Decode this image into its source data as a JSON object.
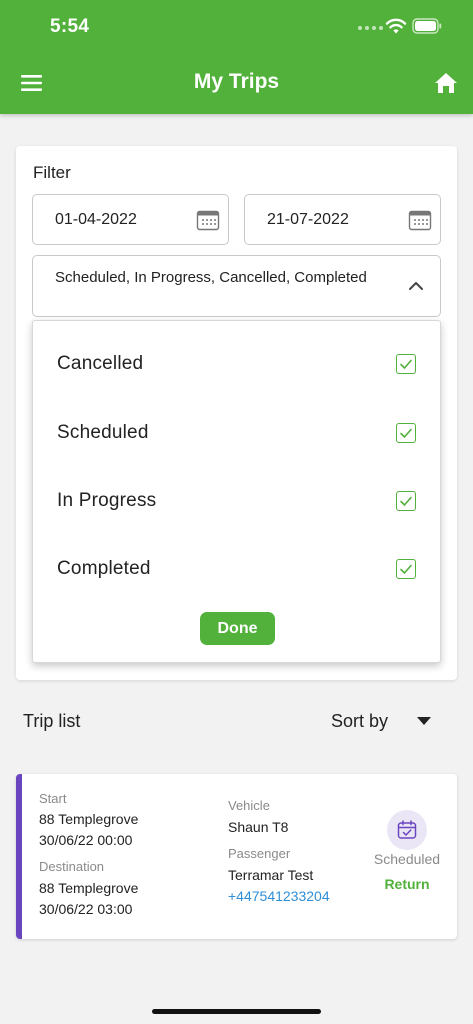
{
  "status_bar": {
    "time": "5:54"
  },
  "header": {
    "title": "My Trips"
  },
  "filter": {
    "label": "Filter",
    "date_from": "01-04-2022",
    "date_to": "21-07-2022",
    "status_selected": "Scheduled,  In Progress,  Cancelled, Completed",
    "options": [
      {
        "label": "Cancelled",
        "checked": true
      },
      {
        "label": "Scheduled",
        "checked": true
      },
      {
        "label": "In Progress",
        "checked": true
      },
      {
        "label": "Completed",
        "checked": true
      }
    ],
    "done_label": "Done"
  },
  "trips": {
    "label": "Trip list",
    "sort_label": "Sort by",
    "items": [
      {
        "start_caption": "Start",
        "start_address": "88 Templegrove",
        "start_time": "30/06/22 00:00",
        "destination_caption": "Destination",
        "destination_address": "88 Templegrove",
        "destination_time": "30/06/22 03:00",
        "vehicle_caption": "Vehicle",
        "vehicle": "Shaun T8",
        "passenger_caption": "Passenger",
        "passenger": "Terramar Test",
        "phone": "+447541233204",
        "status": "Scheduled",
        "action": "Return"
      }
    ]
  },
  "colors": {
    "primary": "#52b13a",
    "accent": "#6a45c0",
    "link": "#2f8fd6"
  },
  "icons": [
    "menu-icon",
    "home-icon",
    "calendar-icon",
    "chevron-up-icon",
    "checkbox-checked-icon",
    "caret-down-icon",
    "calendar-check-icon",
    "wifi-icon",
    "battery-icon"
  ]
}
